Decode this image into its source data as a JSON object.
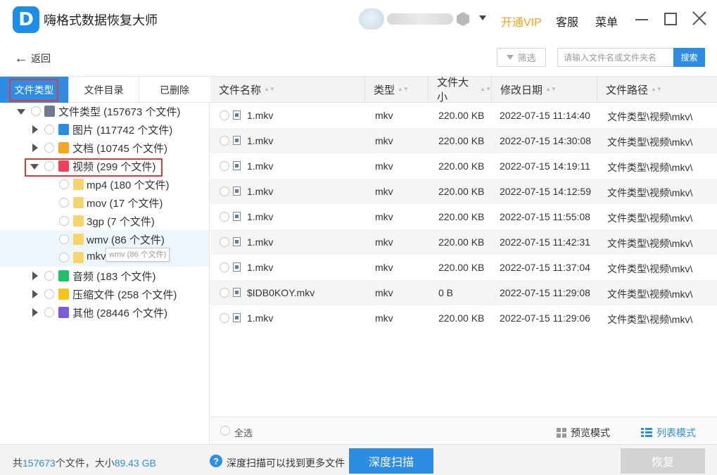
{
  "app": {
    "title": "嗨格式数据恢复大师",
    "logo_letter": "D",
    "vip_label": "开通VIP",
    "service_label": "客服",
    "menu_label": "菜单"
  },
  "toolbar": {
    "back_label": "返回",
    "back_icon": "←",
    "filter_label": "筛选",
    "search_placeholder": "请输入文件名或文件夹名",
    "search_button": "搜索"
  },
  "sidebar": {
    "tabs": [
      "文件类型",
      "文件目录",
      "已删除"
    ],
    "tree": [
      {
        "label": "文件类型 (157673 个文件)",
        "expanded": true,
        "icon": "drive-icon",
        "color": "#6d7b8d"
      },
      {
        "label": "图片 (117742 个文件)",
        "expanded": false,
        "icon": "image-icon",
        "color": "#2d8de4"
      },
      {
        "label": "文档 (10745 个文件)",
        "expanded": false,
        "icon": "document-icon",
        "color": "#f5a623"
      },
      {
        "label": "视频 (299 个文件)",
        "expanded": true,
        "icon": "video-icon",
        "color": "#f0405b"
      },
      {
        "label": "mp4 (180 个文件)",
        "icon": "folder-icon",
        "color": "#f8d56b"
      },
      {
        "label": "mov (17 个文件)",
        "icon": "folder-icon",
        "color": "#f8d56b"
      },
      {
        "label": "3gp (7 个文件)",
        "icon": "folder-icon",
        "color": "#f8d56b"
      },
      {
        "label": "wmv (86 个文件)",
        "icon": "folder-icon",
        "color": "#f8d56b"
      },
      {
        "label": "mkv",
        "icon": "folder-icon",
        "color": "#f8d56b"
      },
      {
        "label": "音频 (183 个文件)",
        "expanded": false,
        "icon": "audio-icon",
        "color": "#1ec26b"
      },
      {
        "label": "压缩文件 (258 个文件)",
        "expanded": false,
        "icon": "archive-icon",
        "color": "#f7c518"
      },
      {
        "label": "其他 (28446 个文件)",
        "expanded": false,
        "icon": "other-icon",
        "color": "#7b5be0"
      }
    ],
    "tooltip": "wmv (86 个文件)"
  },
  "table": {
    "headers": [
      "文件名称",
      "类型",
      "文件大小",
      "修改日期",
      "文件路径"
    ],
    "rows": [
      {
        "name": "1.mkv",
        "type": "mkv",
        "size": "220.00 KB",
        "date": "2022-07-15 11:14:40",
        "path": "文件类型\\视频\\mkv\\"
      },
      {
        "name": "1.mkv",
        "type": "mkv",
        "size": "220.00 KB",
        "date": "2022-07-15 14:30:08",
        "path": "文件类型\\视频\\mkv\\"
      },
      {
        "name": "1.mkv",
        "type": "mkv",
        "size": "220.00 KB",
        "date": "2022-07-15 14:19:11",
        "path": "文件类型\\视频\\mkv\\"
      },
      {
        "name": "1.mkv",
        "type": "mkv",
        "size": "220.00 KB",
        "date": "2022-07-15 14:12:59",
        "path": "文件类型\\视频\\mkv\\"
      },
      {
        "name": "1.mkv",
        "type": "mkv",
        "size": "220.00 KB",
        "date": "2022-07-15 11:55:08",
        "path": "文件类型\\视频\\mkv\\"
      },
      {
        "name": "1.mkv",
        "type": "mkv",
        "size": "220.00 KB",
        "date": "2022-07-15 11:42:31",
        "path": "文件类型\\视频\\mkv\\"
      },
      {
        "name": "1.mkv",
        "type": "mkv",
        "size": "220.00 KB",
        "date": "2022-07-15 11:37:04",
        "path": "文件类型\\视频\\mkv\\"
      },
      {
        "name": "$IDB0KOY.mkv",
        "type": "mkv",
        "size": "0 B",
        "date": "2022-07-15 11:29:08",
        "path": "文件类型\\视频\\mkv\\"
      },
      {
        "name": "1.mkv",
        "type": "mkv",
        "size": "220.00 KB",
        "date": "2022-07-15 11:29:06",
        "path": "文件类型\\视频\\mkv\\"
      }
    ],
    "select_all": "全选",
    "preview_mode": "预览模式",
    "list_mode": "列表模式"
  },
  "status": {
    "prefix": "共",
    "file_count": "157673",
    "mid": "个文件，大小",
    "total_size": "89.43 GB",
    "deep_hint": "深度扫描可以找到更多文件",
    "deep_scan_button": "深度扫描",
    "recover_button": "恢复"
  },
  "colors": {
    "accent": "#2d8de4",
    "vip": "#f0a41b",
    "highlight_border": "#e53935"
  }
}
